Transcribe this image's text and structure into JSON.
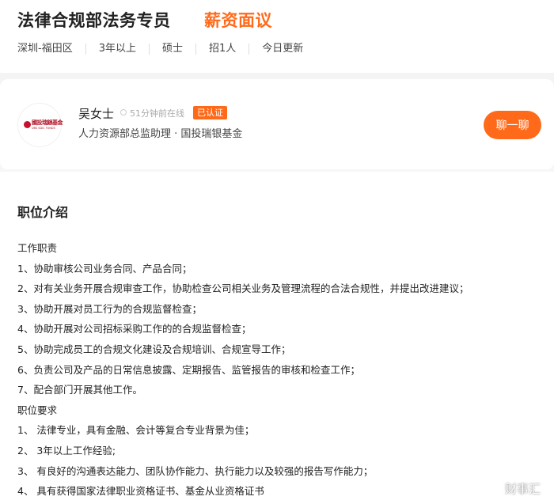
{
  "job": {
    "title": "法律合规部法务专员",
    "salary": "薪资面议",
    "tags": [
      "深圳-福田区",
      "3年以上",
      "硕士",
      "招1人",
      "今日更新"
    ]
  },
  "recruiter": {
    "name": "吴女士",
    "online_status": "51分钟前在线",
    "verified_badge": "已认证",
    "position": "人力资源部总监助理 · 国投瑞银基金",
    "company_logo_text": "國投瑞銀基金",
    "company_logo_subtext": "UBS SDIC FUNDS",
    "chat_button": "聊一聊"
  },
  "description": {
    "section_title": "职位介绍",
    "lines": [
      "工作职责",
      "1、协助审核公司业务合同、产品合同；",
      "2、对有关业务开展合规审查工作，协助检查公司相关业务及管理流程的合法合规性，并提出改进建议；",
      "3、协助开展对员工行为的合规监督检查；",
      "4、协助开展对公司招标采购工作的的合规监督检查；",
      "5、协助完成员工的合规文化建设及合规培训、合规宣导工作；",
      "6、负责公司及产品的日常信息披露、定期报告、监管报告的审核和检查工作；",
      "7、配合部门开展其他工作。",
      "职位要求",
      "1、 法律专业，具有金融、会计等复合专业背景为佳；",
      "2、 3年以上工作经验;",
      "3、 有良好的沟通表达能力、团队协作能力、执行能力以及较强的报告写作能力；",
      "4、 具有获得国家法律职业资格证书、基金从业资格证书"
    ]
  },
  "watermark": {
    "text": "财事汇",
    "icon": "weibo-icon"
  },
  "colors": {
    "accent": "#ff6a1a",
    "text": "#222222",
    "muted": "#aaaaaa"
  }
}
